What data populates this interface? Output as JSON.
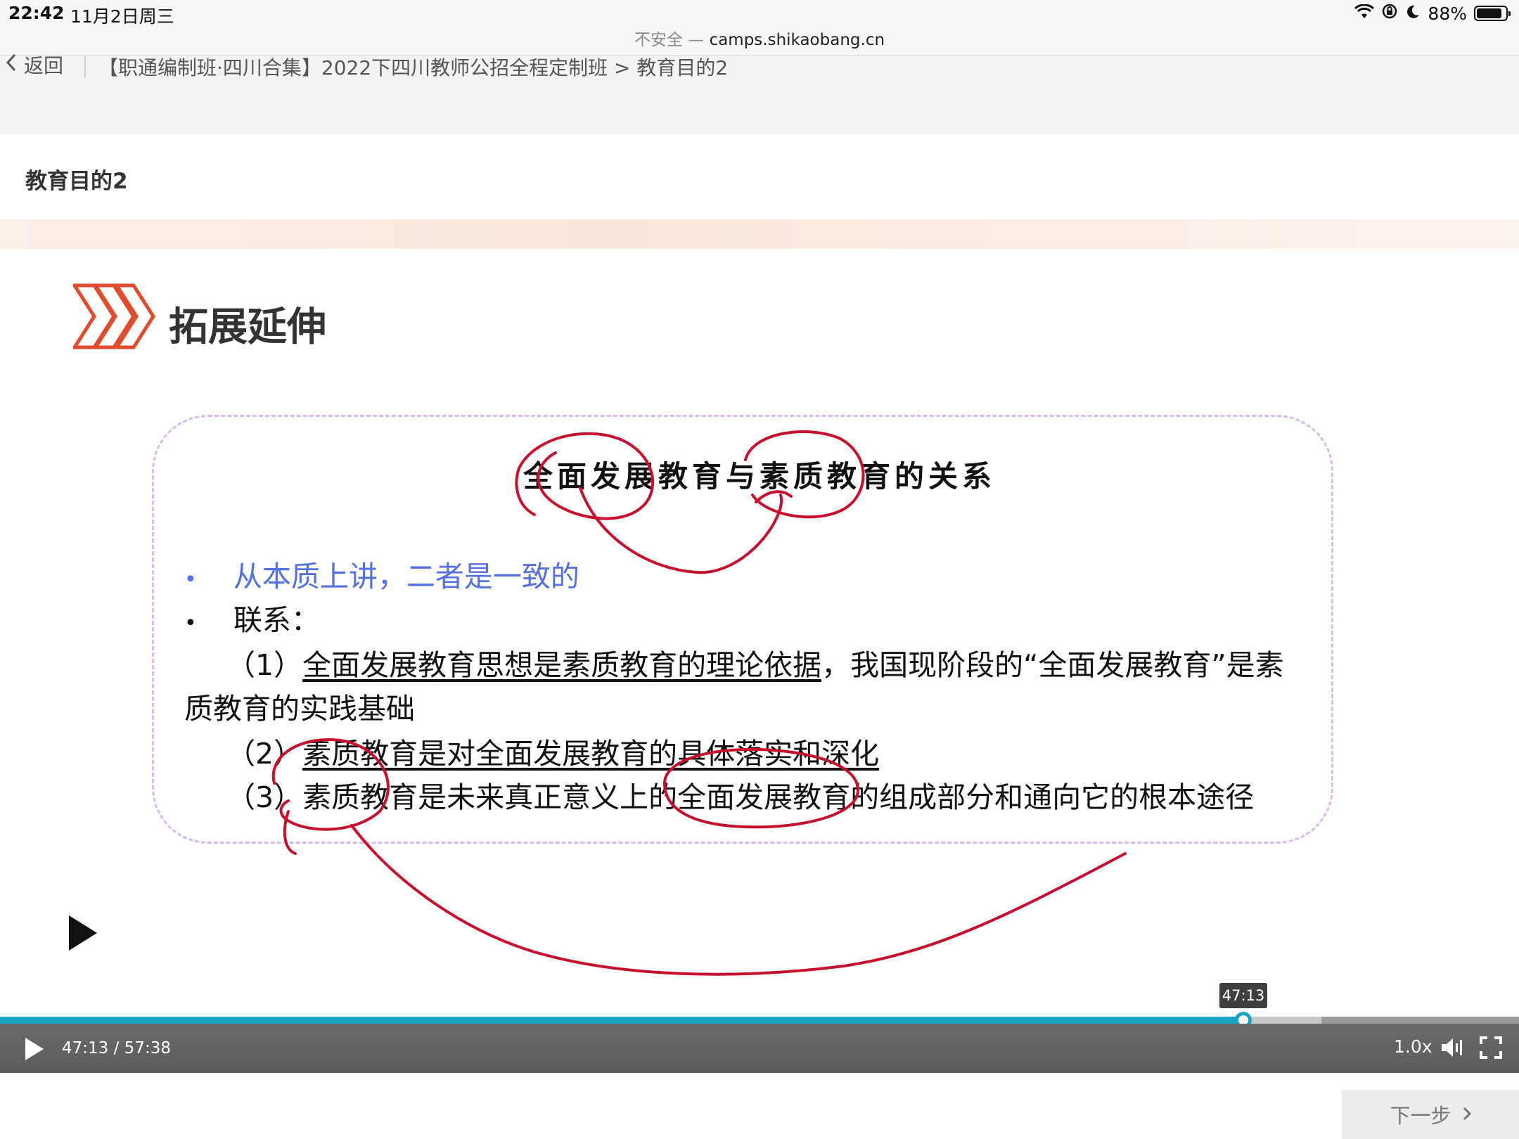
{
  "status_bar": {
    "time": "22:42",
    "date": "11月2日周三",
    "battery": "88%",
    "battery_level": 0.88,
    "icons": [
      "wifi-icon",
      "orientation-lock-icon",
      "moon-icon",
      "battery-icon"
    ]
  },
  "browser": {
    "insecure_label": "不安全 —",
    "host": "camps.shikaobang.cn"
  },
  "nav": {
    "back_label": "返回",
    "breadcrumb": "【职通编制班·四川合集】2022下四川教师公招全程定制班 > 教育目的2"
  },
  "page": {
    "title": "教育目的2"
  },
  "slide": {
    "heading": "拓展延伸",
    "box_title": "全面发展教育与素质教育的关系",
    "bullet": "•",
    "line1": "从本质上讲，二者是一致的",
    "line2": "联系：",
    "line3_prefix": "（1）",
    "line3_underlined": "全面发展教育思想是素质教育的理论依据",
    "line3_rest": "，我国现阶段的“全面发展教育”是素",
    "line4": "质教育的实践基础",
    "line5_prefix": "（2）",
    "line5_underlined": "素质教育是对全面发展教育的具体落实和深化",
    "line6_prefix": "（3）",
    "line6_text": "素质教育是未来真正意义上的全面发展教育的组成部分和通向它的根本途径",
    "accent_color": "#e24a2e",
    "highlight_color": "#5670e4",
    "annotation_color": "#c8102e"
  },
  "player": {
    "tooltip_time": "47:13",
    "current_time": "47:13",
    "separator": "/",
    "duration": "57:38",
    "played_fraction": 0.8185,
    "buffered_fraction": 0.87,
    "speed": "1.0x",
    "accent_color": "#1aa3c2"
  },
  "footer": {
    "next_label": "下一步"
  }
}
